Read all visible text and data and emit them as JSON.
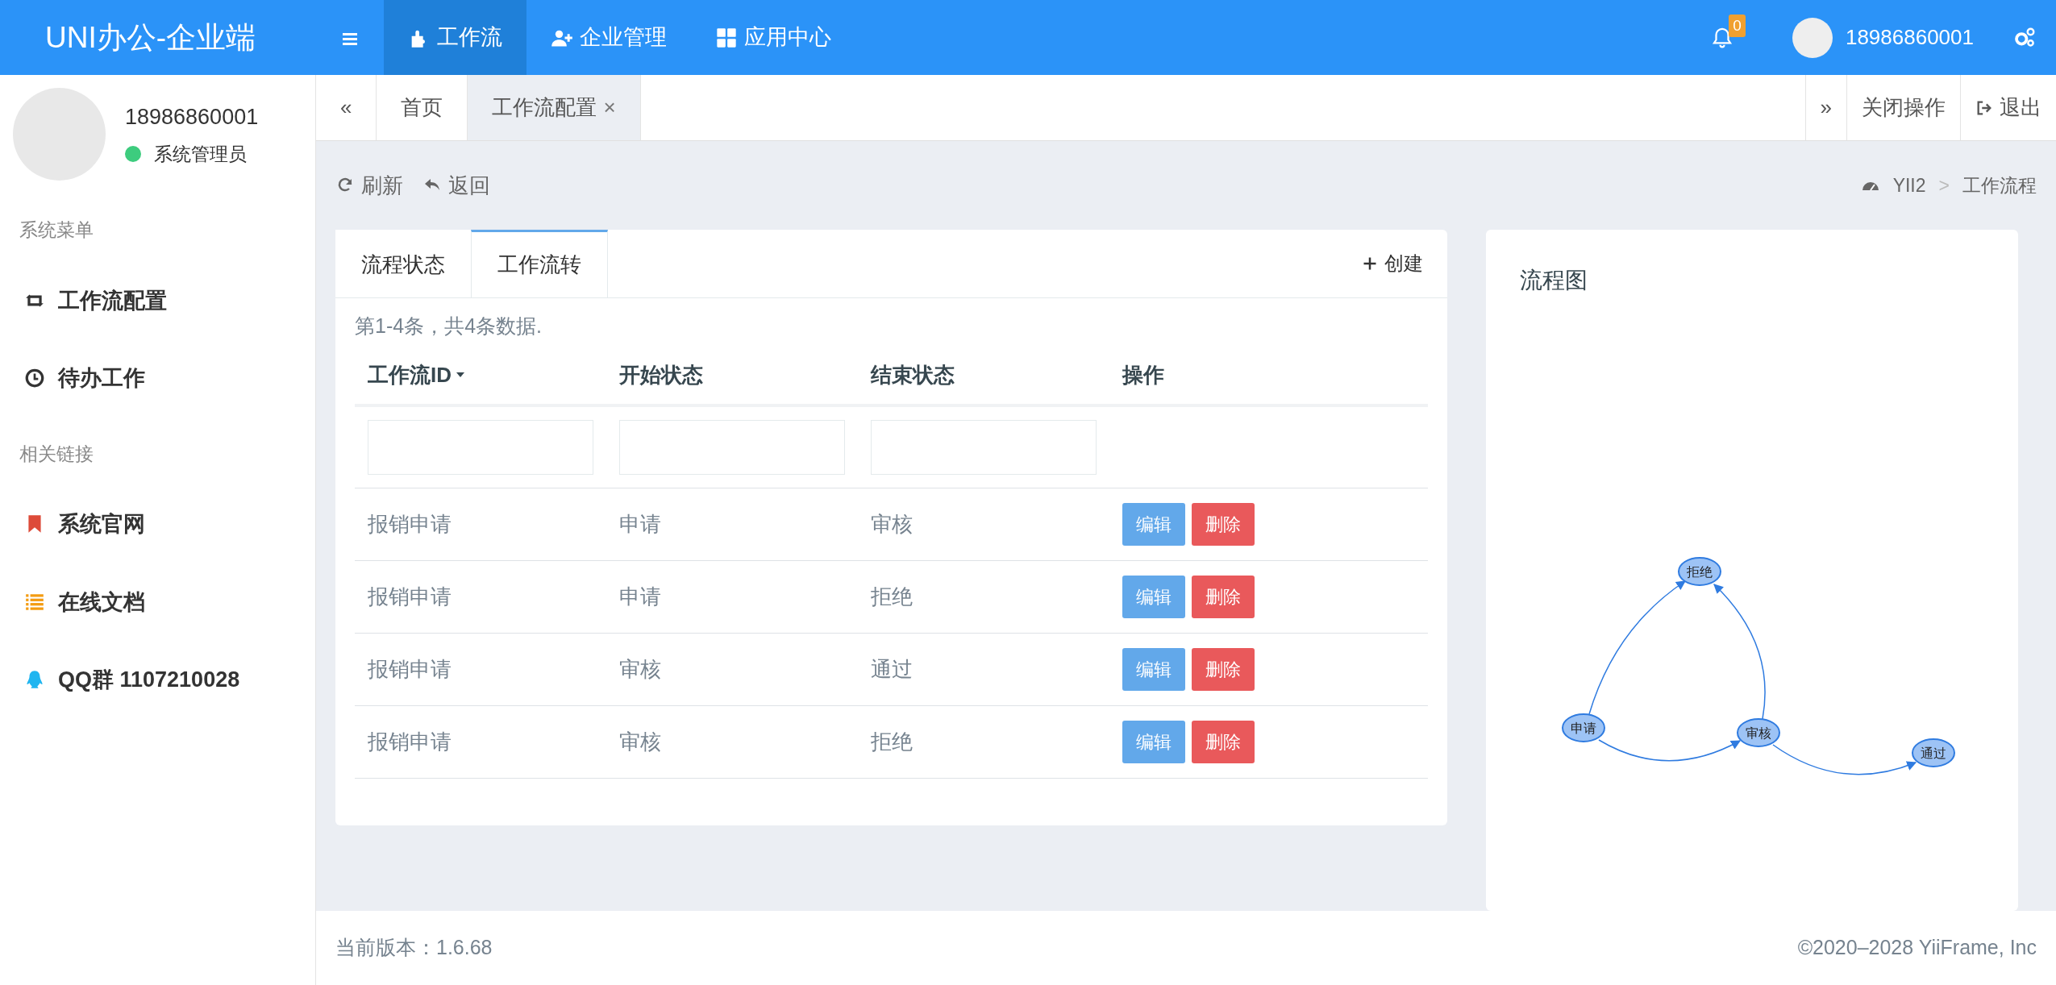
{
  "header": {
    "brand": "UNI办公-企业端",
    "nav": [
      {
        "label": "工作流",
        "selected": true
      },
      {
        "label": "企业管理",
        "selected": false
      },
      {
        "label": "应用中心",
        "selected": false
      }
    ],
    "notification_count": "0",
    "user": "18986860001"
  },
  "sidebar": {
    "user": {
      "name": "18986860001",
      "role": "系统管理员"
    },
    "sections": [
      {
        "title": "系统菜单",
        "items": [
          {
            "label": "工作流配置"
          },
          {
            "label": "待办工作"
          }
        ]
      },
      {
        "title": "相关链接",
        "items": [
          {
            "label": "系统官网"
          },
          {
            "label": "在线文档"
          },
          {
            "label": "QQ群 1107210028"
          }
        ]
      }
    ]
  },
  "page_tabs": {
    "scroll_left": "«",
    "tabs": [
      {
        "label": "首页",
        "selected": false
      },
      {
        "label": "工作流配置",
        "selected": true,
        "close": "×"
      }
    ],
    "scroll_right": "»",
    "close_ops": "关闭操作",
    "logout": "退出"
  },
  "toolbar": {
    "refresh": "刷新",
    "back": "返回"
  },
  "breadcrumb": {
    "items": [
      "YII2",
      "工作流程"
    ],
    "separator": ">"
  },
  "workflow_card": {
    "tabs": [
      {
        "label": "流程状态",
        "selected": false
      },
      {
        "label": "工作流转",
        "selected": true
      }
    ],
    "create": "创建",
    "summary": "第1-4条，共4条数据.",
    "columns": [
      {
        "label": "工作流ID",
        "sorted_descending": true,
        "filter": true
      },
      {
        "label": "开始状态",
        "filter": true
      },
      {
        "label": "结束状态",
        "filter": true
      },
      {
        "label": "操作",
        "filter": false
      }
    ],
    "rows": [
      {
        "workflow": "报销申请",
        "start": "申请",
        "end": "审核",
        "actions": [
          "编辑",
          "删除"
        ]
      },
      {
        "workflow": "报销申请",
        "start": "申请",
        "end": "拒绝",
        "actions": [
          "编辑",
          "删除"
        ]
      },
      {
        "workflow": "报销申请",
        "start": "审核",
        "end": "通过",
        "actions": [
          "编辑",
          "删除"
        ]
      },
      {
        "workflow": "报销申请",
        "start": "审核",
        "end": "拒绝",
        "actions": [
          "编辑",
          "删除"
        ]
      }
    ]
  },
  "flow_card": {
    "title": "流程图",
    "nodes": [
      "拒绝",
      "申请",
      "审核",
      "通过"
    ]
  },
  "footer": {
    "version": "当前版本：1.6.68",
    "copyright": "©2020–2028 YiiFrame, Inc"
  }
}
